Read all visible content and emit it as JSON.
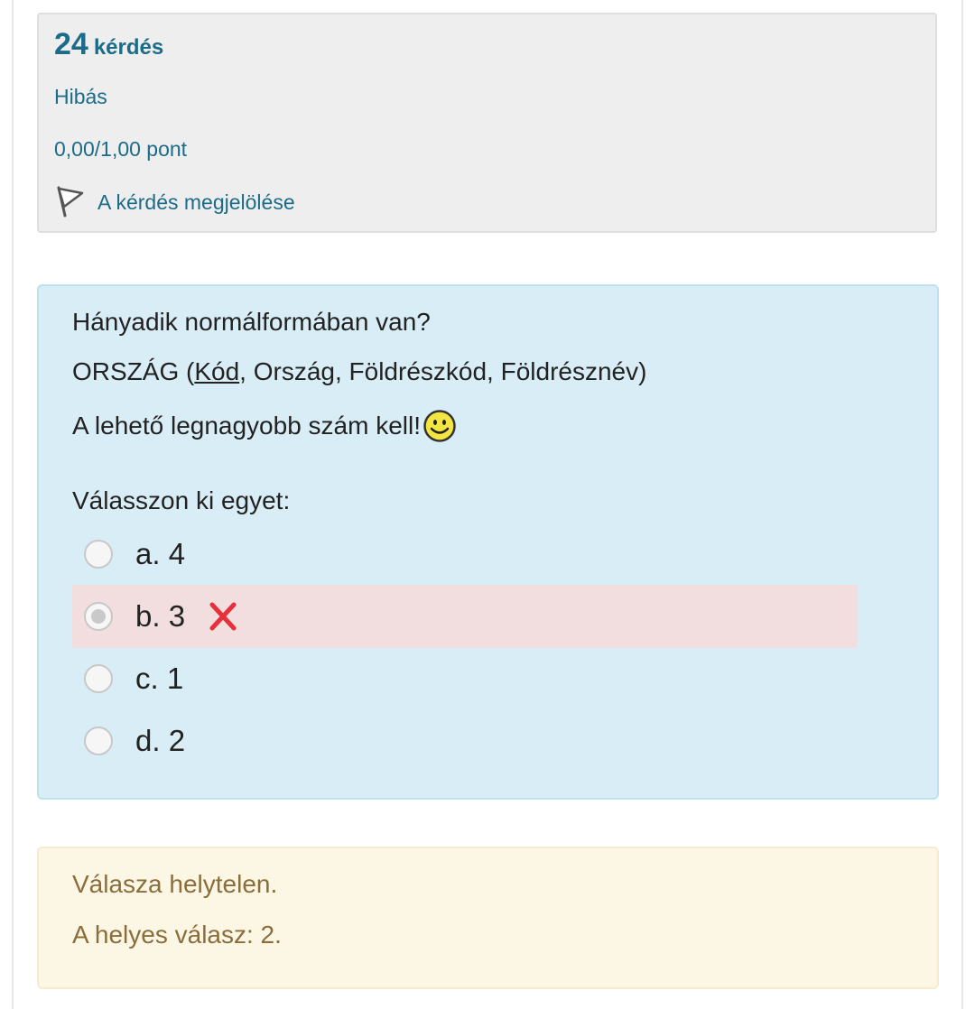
{
  "info": {
    "question_number": "24",
    "question_word": "kérdés",
    "state": "Hibás",
    "grade": "0,00/1,00 pont",
    "flag_label": "A kérdés megjelölése"
  },
  "question": {
    "line1": "Hányadik normálformában van?",
    "line2_prefix": "ORSZÁG (",
    "line2_key": "Kód",
    "line2_suffix": ", Ország, Földrészkód, Földrésznév)",
    "line3": "A lehető legnagyobb szám kell!",
    "prompt": "Válasszon ki egyet:",
    "options": [
      {
        "label": "a. 4",
        "selected": false
      },
      {
        "label": "b. 3",
        "selected": true,
        "incorrect": true
      },
      {
        "label": "c. 1",
        "selected": false
      },
      {
        "label": "d. 2",
        "selected": false
      }
    ]
  },
  "feedback": {
    "result": "Válasza helytelen.",
    "correct_answer": "A helyes válasz: 2."
  },
  "colors": {
    "link": "#1c6b88",
    "question_bg": "#d9edf6",
    "incorrect_bg": "#f2dede",
    "feedback_bg": "#fcf7e4",
    "feedback_text": "#8a6d3b",
    "x_mark": "#e8303a"
  },
  "icons": {
    "flag": "flag-icon",
    "smiley": "smiley-icon",
    "incorrect": "x-mark-icon"
  }
}
